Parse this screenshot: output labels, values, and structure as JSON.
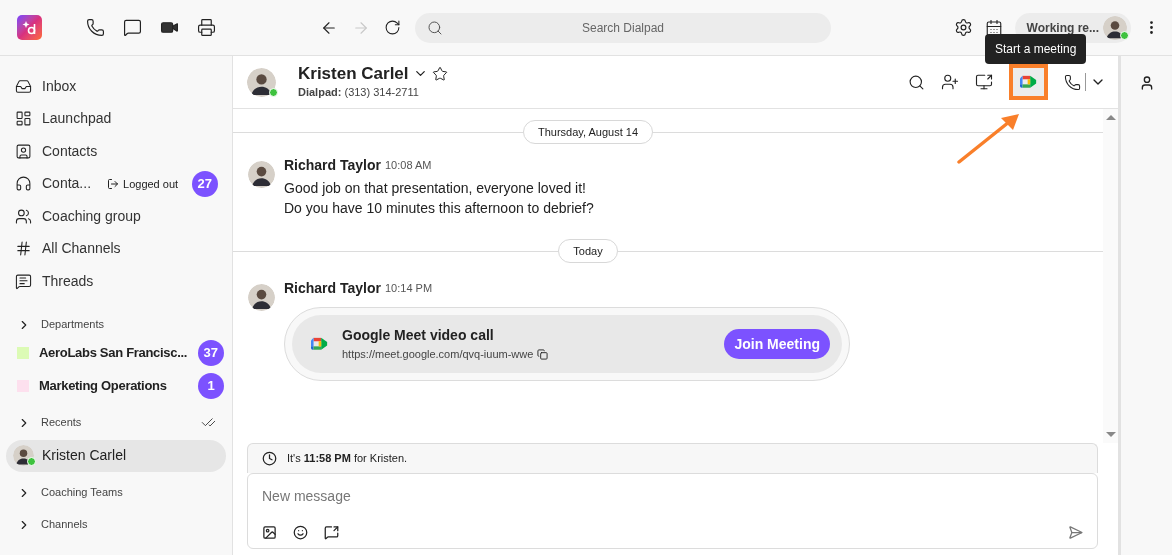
{
  "top_bar": {
    "search": {
      "placeholder": "Search Dialpad"
    },
    "status": "Working re...",
    "online": true
  },
  "sidebar": {
    "nav": [
      {
        "label": "Inbox"
      },
      {
        "label": "Launchpad"
      },
      {
        "label": "Contacts"
      },
      {
        "label": "Conta...",
        "status": "Logged out",
        "badge": "27"
      },
      {
        "label": "Coaching group"
      },
      {
        "label": "All Channels"
      },
      {
        "label": "Threads"
      }
    ],
    "sections": [
      {
        "title": "Departments",
        "items": [
          {
            "label": "AeroLabs San Francisc...",
            "color": "#dcfbb5",
            "badge": "37"
          },
          {
            "label": "Marketing Operations",
            "color": "#fde0ee",
            "badge": "1"
          }
        ]
      },
      {
        "title": "Recents",
        "mark_read": true,
        "contacts": [
          {
            "label": "Kristen Carlel",
            "selected": true,
            "online": true
          }
        ]
      },
      {
        "title": "Coaching Teams"
      },
      {
        "title": "Channels"
      }
    ]
  },
  "conversation": {
    "name": "Kristen Carlel",
    "online": true,
    "line": "**Dialpad:** (313) 314-2711",
    "meet_button": {
      "highlighted": true,
      "tooltip": "Start a meeting"
    }
  },
  "feed": [
    {
      "kind": "divider",
      "label": "Thursday, August 14"
    },
    {
      "kind": "message",
      "author": "Richard Taylor",
      "time": "10:08 AM",
      "lines": [
        "Good job on that presentation, everyone loved it!",
        "Do you have 10 minutes this afternoon to debrief?"
      ]
    },
    {
      "kind": "divider",
      "label": "Today"
    },
    {
      "kind": "meeting",
      "author": "Richard Taylor",
      "time": "10:14 PM",
      "title": "Google Meet video call",
      "url": "https://meet.google.com/qvq-iuum-wwe",
      "button": "Join Meeting"
    }
  ],
  "local_time": "It's **11:58 PM** for Kristen.",
  "composer": {
    "placeholder": "New message"
  }
}
